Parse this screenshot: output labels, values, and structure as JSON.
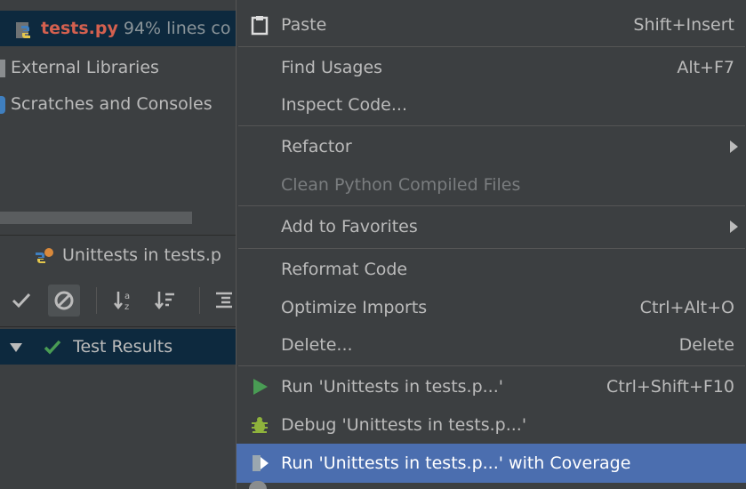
{
  "project": {
    "tests_file": "tests.py",
    "coverage": "94% lines co",
    "external_libraries": "External Libraries",
    "scratches": "Scratches and Consoles"
  },
  "run_window": {
    "tab_title": "Unittests in tests.p",
    "test_results": "Test Results"
  },
  "context_menu": {
    "paste": {
      "label": "Paste",
      "shortcut": "Shift+Insert"
    },
    "find_usages": {
      "label": "Find Usages",
      "shortcut": "Alt+F7"
    },
    "inspect_code": {
      "label": "Inspect Code..."
    },
    "refactor": {
      "label": "Refactor"
    },
    "clean_compiled": {
      "label": "Clean Python Compiled Files"
    },
    "add_favorites": {
      "label": "Add to Favorites"
    },
    "reformat_code": {
      "label": "Reformat Code"
    },
    "optimize_imports": {
      "label": "Optimize Imports",
      "shortcut": "Ctrl+Alt+O"
    },
    "delete": {
      "label": "Delete...",
      "shortcut": "Delete"
    },
    "run": {
      "label": "Run 'Unittests in tests.p...'",
      "shortcut": "Ctrl+Shift+F10"
    },
    "debug": {
      "label": "Debug 'Unittests in tests.p...'"
    },
    "run_coverage": {
      "label": "Run 'Unittests in tests.p...' with Coverage"
    }
  },
  "colors": {
    "background": "#3c3f41",
    "selection": "#4b6eaf",
    "tree_selection": "#0d293e",
    "run_green": "#499c54",
    "file_red": "#d4604f"
  }
}
